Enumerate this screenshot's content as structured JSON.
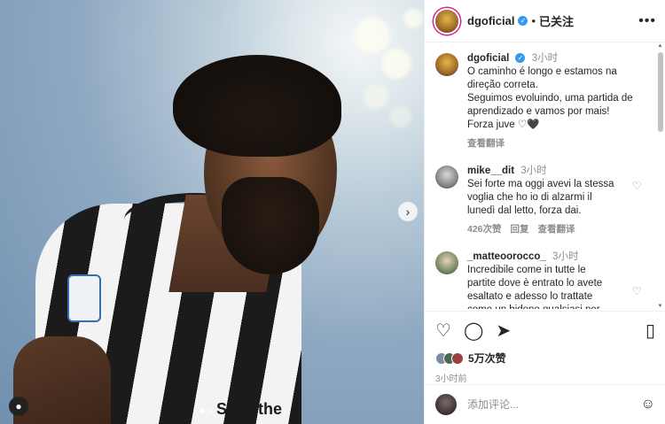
{
  "post": {
    "author": "dgoficial",
    "follow_state": "已关注",
    "separator": "•",
    "more_icon": "•••",
    "next_icon": "›",
    "user_tag_icon": "●",
    "jersey_text": "Save the"
  },
  "comments": [
    {
      "user": "dgoficial",
      "verified": true,
      "time": "3小时",
      "text": "O caminho é longo e estamos na\ndireção correta.\nSeguimos evoluindo, uma partida de\naprendizado e vamos por mais!\nForza juve ♡🖤",
      "translate": "查看翻译"
    },
    {
      "user": "mike__dit",
      "time": "3小时",
      "text": "Sei forte ma oggi avevi la stessa\nvoglia che ho io di alzarmi il\nlunedì dal letto, forza dai.",
      "likes": "426次赞",
      "reply": "回复",
      "translate": "查看翻译"
    },
    {
      "user": "_matteoorocco_",
      "time": "3小时",
      "text": "Incredibile come in tutte le\npartite dove è entrato lo avete\nesaltato e adesso lo trattate\ncome un bidone qualsiasi per\nuna giornata no. E voi sareste"
    }
  ],
  "actions": {
    "like_icon": "♡",
    "comment_icon": "◯",
    "share_icon": "➤",
    "save_icon": "▯",
    "like_count": "5万次赞",
    "post_time": "3小时前"
  },
  "composer": {
    "placeholder": "添加评论...",
    "emoji_icon": "☺"
  },
  "colors": {
    "accent": "#3897f0",
    "story_ring": "#d6249f",
    "muted_text": "#8e8e8e"
  }
}
